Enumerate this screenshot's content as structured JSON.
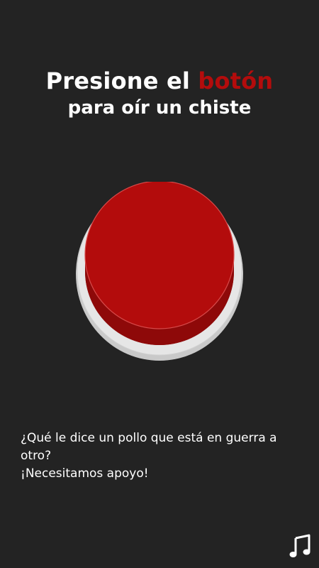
{
  "header": {
    "title_prefix": "Presione el ",
    "title_accent": "botón",
    "subtitle": "para oír un chiste"
  },
  "joke": {
    "question": "¿Qué le dice un pollo que está en guerra a otro?",
    "answer": "¡Necesitamos apoyo!"
  },
  "icons": {
    "music": "music-note-icon"
  },
  "colors": {
    "background": "#232323",
    "accent": "#b30c0c",
    "button_top": "#b30c0c",
    "button_side": "#8e0909",
    "button_base": "#e6e6e6",
    "text": "#ffffff"
  }
}
